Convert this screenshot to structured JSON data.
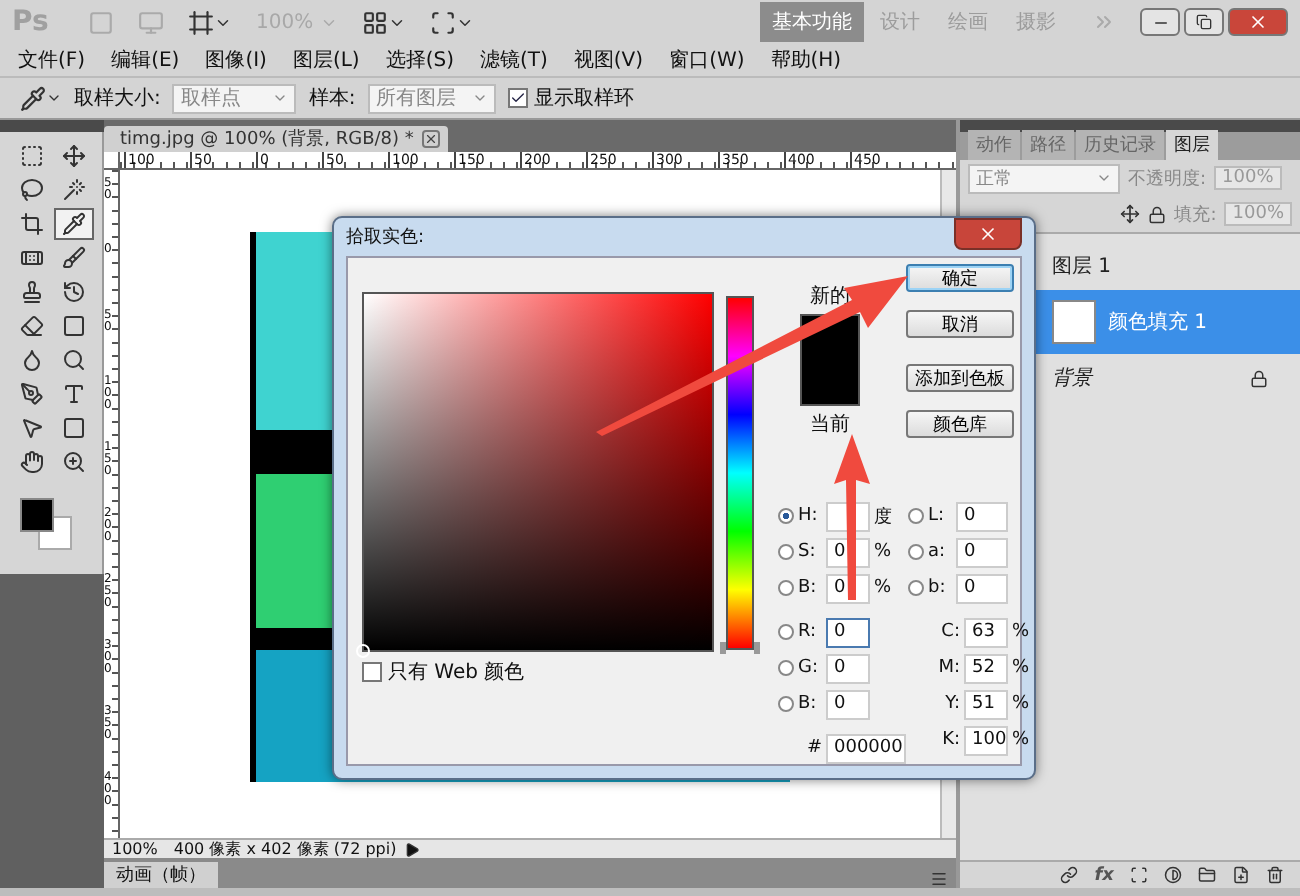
{
  "title_bar": {
    "logo": "Ps",
    "zoom": "100%",
    "workspaces": [
      {
        "label": "基本功能",
        "selected": true
      },
      {
        "label": "设计",
        "selected": false
      },
      {
        "label": "绘画",
        "selected": false
      },
      {
        "label": "摄影",
        "selected": false
      }
    ]
  },
  "menu": [
    "文件(F)",
    "编辑(E)",
    "图像(I)",
    "图层(L)",
    "选择(S)",
    "滤镜(T)",
    "视图(V)",
    "窗口(W)",
    "帮助(H)"
  ],
  "options_bar": {
    "sample_size_label": "取样大小:",
    "sample_size": "取样点",
    "sample_label": "样本:",
    "sample": "所有图层",
    "show_ring": {
      "label": "显示取样环",
      "checked": true
    }
  },
  "tools": [
    {
      "selected": false
    },
    {
      "selected": false
    },
    {
      "selected": false
    },
    {
      "selected": false
    },
    {
      "selected": false
    },
    {
      "selected": true
    },
    {
      "selected": false
    },
    {
      "selected": false
    },
    {
      "selected": false
    },
    {
      "selected": false
    },
    {
      "selected": false
    },
    {
      "selected": false
    },
    {
      "selected": false
    },
    {
      "selected": false
    },
    {
      "selected": false
    },
    {
      "selected": false
    },
    {
      "selected": false
    },
    {
      "selected": false
    },
    {
      "selected": false
    },
    {
      "selected": false
    }
  ],
  "document": {
    "tab": "timg.jpg @ 100% (背景, RGB/8) *",
    "top_ruler": [
      "100",
      "50",
      "0",
      "50",
      "100",
      "150",
      "200",
      "250",
      "300",
      "350",
      "400",
      "450"
    ],
    "left_ruler": [
      "50",
      "0",
      "50",
      "100",
      "150",
      "200",
      "250",
      "300",
      "350",
      "400"
    ],
    "zoom": "100%",
    "info": "400 像素 x 402 像素 (72 ppi)"
  },
  "timeline": {
    "tab": "动画（帧）"
  },
  "panels": {
    "tabs": [
      {
        "label": "动作",
        "selected": false
      },
      {
        "label": "路径",
        "selected": false
      },
      {
        "label": "历史记录",
        "selected": false
      },
      {
        "label": "图层",
        "selected": true
      }
    ],
    "blend_mode": "正常",
    "opacity_label": "不透明度:",
    "opacity": "100%",
    "fill_label": "填充:",
    "fill": "100%",
    "layers": [
      {
        "name": "图层 1",
        "selected": false,
        "kind": "plain"
      },
      {
        "name": "颜色填充 1",
        "selected": true,
        "kind": "fill"
      },
      {
        "name": "背景",
        "selected": false,
        "kind": "background"
      }
    ],
    "fx_label": "fx"
  },
  "dialog": {
    "title": "拾取实色:",
    "new_label": "新的",
    "current_label": "当前",
    "buttons": [
      {
        "label": "确定",
        "selected": true
      },
      {
        "label": "取消",
        "selected": false
      },
      {
        "label": "添加到色板",
        "selected": false
      },
      {
        "label": "颜色库",
        "selected": false
      }
    ],
    "hue_slider": {
      "level": 0
    },
    "only_web": {
      "label": "只有 Web 颜色",
      "checked": false
    },
    "fields_left": [
      {
        "label": "H:",
        "unit": "度",
        "selected": true
      },
      {
        "label": "S:",
        "value": "0",
        "unit": "%",
        "selected": false
      },
      {
        "label": "B:",
        "value": "0",
        "unit": "%",
        "selected": false
      },
      {
        "label": "R:",
        "value": "0",
        "selected": false
      },
      {
        "label": "G:",
        "value": "0",
        "selected": false
      },
      {
        "label": "B:",
        "value": "0",
        "selected": false
      }
    ],
    "fields_right": [
      {
        "label": "L:",
        "value": "0",
        "kind": "radio",
        "selected": false
      },
      {
        "label": "a:",
        "value": "0",
        "kind": "radio",
        "selected": false
      },
      {
        "label": "b:",
        "value": "0",
        "kind": "radio",
        "selected": false
      },
      {
        "label": "C:",
        "value": "63",
        "unit": "%",
        "kind": "plain"
      },
      {
        "label": "M:",
        "value": "52",
        "unit": "%",
        "kind": "plain"
      },
      {
        "label": "Y:",
        "value": "51",
        "unit": "%",
        "kind": "plain"
      },
      {
        "label": "K:",
        "value": "100",
        "unit": "%",
        "kind": "plain"
      }
    ],
    "hex_label": "#",
    "hex": "000000"
  }
}
